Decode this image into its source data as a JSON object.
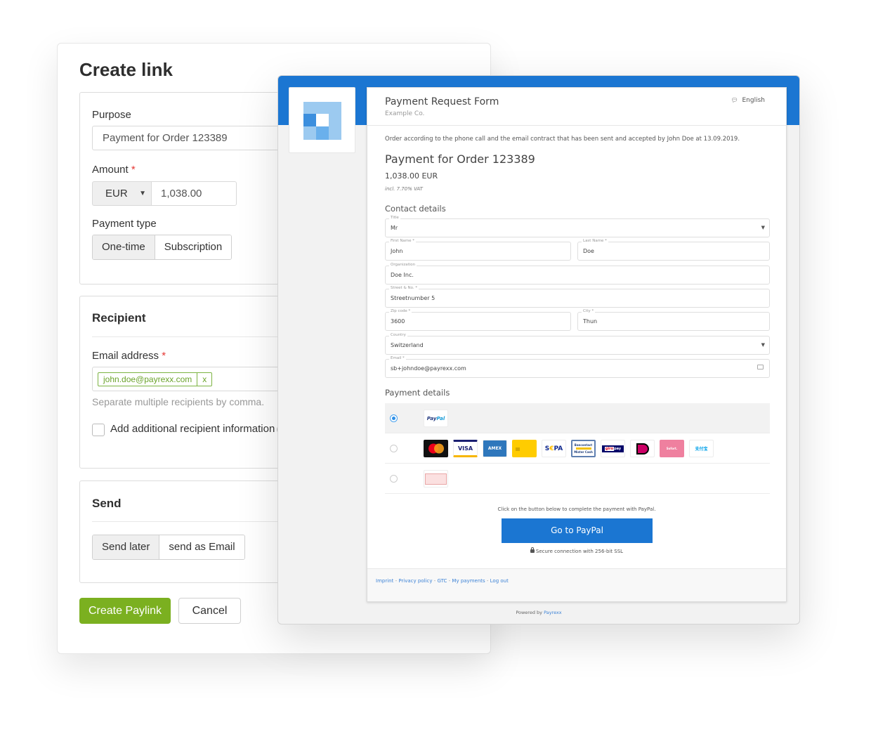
{
  "create_link": {
    "title": "Create link",
    "purpose": {
      "label": "Purpose",
      "value": "Payment for Order 123389"
    },
    "amount": {
      "label": "Amount",
      "required_mark": "*",
      "currency": "EUR",
      "value": "1,038.00"
    },
    "payment_type": {
      "label": "Payment type",
      "options": [
        "One-time",
        "Subscription"
      ],
      "selected": "One-time"
    },
    "recipient": {
      "heading": "Recipient",
      "email_label": "Email address",
      "required_mark": "*",
      "email_tags": [
        {
          "value": "john.doe@payrexx.com",
          "remove": "x"
        }
      ],
      "hint": "Separate multiple recipients by comma.",
      "additional_info_label": "Add additional recipient information",
      "additional_info_checked": false,
      "info_glyph": "i"
    },
    "send": {
      "heading": "Send",
      "options": [
        "Send later",
        "send as Email"
      ],
      "selected": "Send later"
    },
    "buttons": {
      "create": "Create Paylink",
      "cancel": "Cancel"
    },
    "colors": {
      "primary_green": "#7bb020",
      "tag_green": "#7cb342",
      "required_red": "#e53935"
    }
  },
  "payment_form": {
    "title": "Payment Request Form",
    "company": "Example Co.",
    "language": "English",
    "order_note": "Order according to the phone call and the email contract that has been sent and accepted by John Doe at 13.09.2019.",
    "order_title": "Payment for Order 123389",
    "order_amount": "1,038.00 EUR",
    "vat_note": "incl. 7.70% VAT",
    "contact": {
      "heading": "Contact details",
      "fields": {
        "title": {
          "label": "Title",
          "value": "Mr"
        },
        "first_name": {
          "label": "First Name *",
          "value": "John"
        },
        "last_name": {
          "label": "Last Name *",
          "value": "Doe"
        },
        "organization": {
          "label": "Organization",
          "value": "Doe Inc."
        },
        "street": {
          "label": "Street & No. *",
          "value": "Streetnumber 5"
        },
        "zip": {
          "label": "Zip code *",
          "value": "3600"
        },
        "city": {
          "label": "City *",
          "value": "Thun"
        },
        "country": {
          "label": "Country",
          "value": "Switzerland"
        },
        "email": {
          "label": "Email *",
          "value": "sb+johndoe@payrexx.com"
        }
      }
    },
    "payment": {
      "heading": "Payment details",
      "methods": [
        {
          "selected": true,
          "logos": [
            "PayPal"
          ]
        },
        {
          "selected": false,
          "logos": [
            "Mastercard",
            "VISA",
            "AMEX",
            "PostFinance",
            "SEPA",
            "Bancontact Mister Cash",
            "giropay",
            "iDEAL",
            "Sofort",
            "Alipay"
          ]
        },
        {
          "selected": false,
          "logos": [
            "Invoice slip"
          ]
        }
      ],
      "instruction": "Click on the button below to complete the payment with PayPal.",
      "button": "Go to PayPal",
      "secure_note": "Secure connection with 256-bit SSL"
    },
    "footer_links": [
      "Imprint",
      "Privacy policy",
      "GTC",
      "My payments",
      "Log out"
    ],
    "footer_separator": " - ",
    "powered_by": {
      "prefix": "Powered by",
      "brand": "Payrexx"
    },
    "colors": {
      "brand_blue": "#1b76d2",
      "link_blue": "#3d83d6"
    }
  }
}
